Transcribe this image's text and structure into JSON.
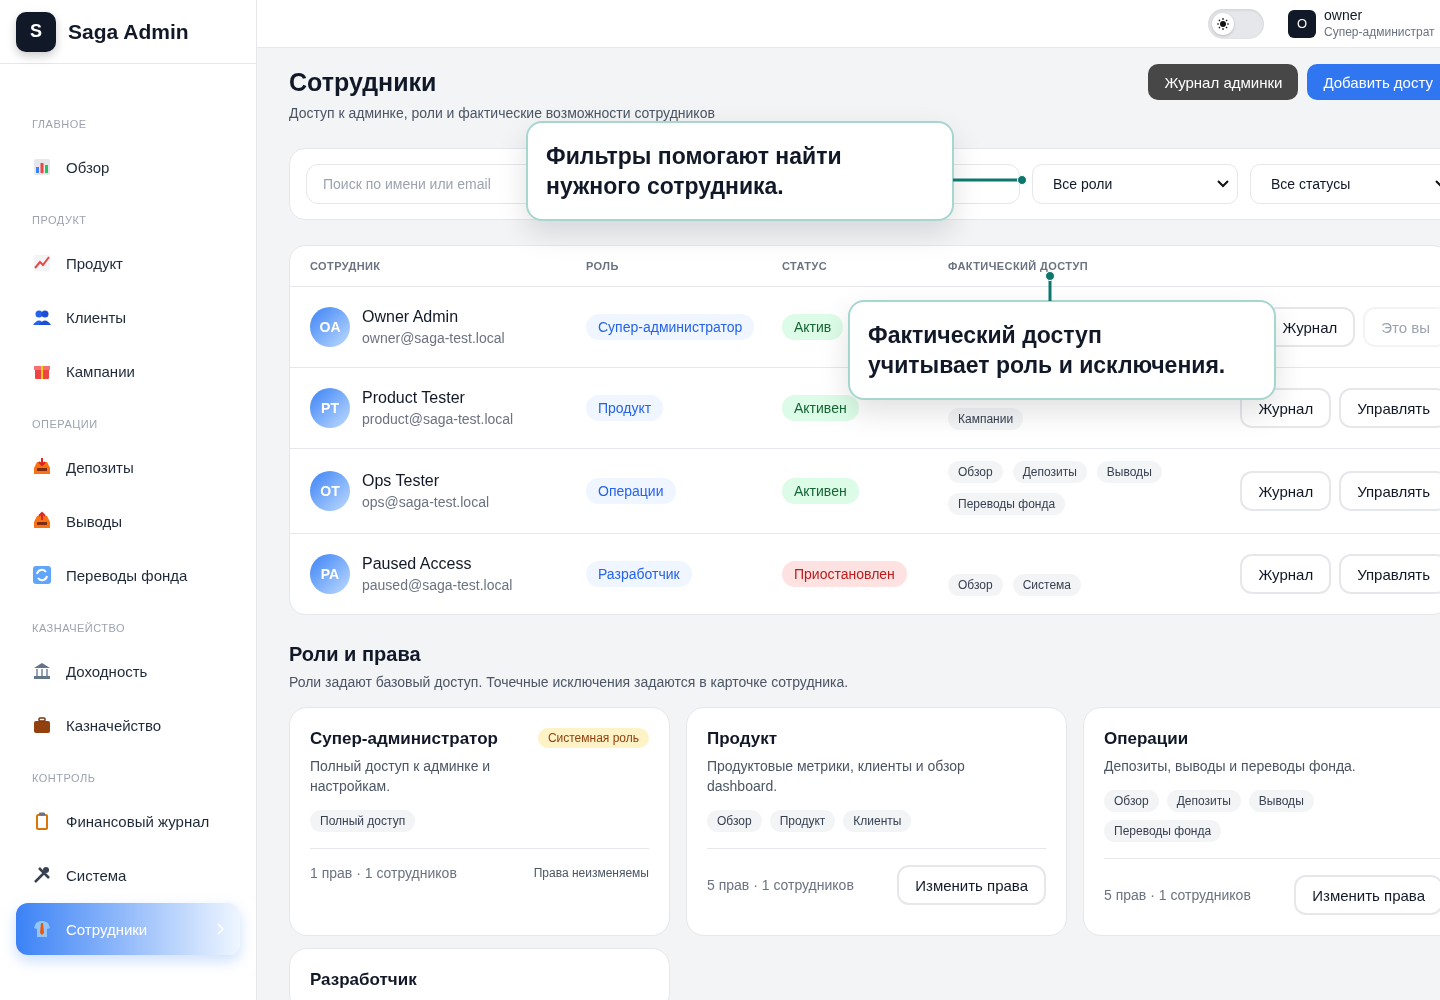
{
  "sidebar": {
    "logo_letter": "S",
    "brand": "Saga Admin",
    "sections": [
      {
        "title": "ГЛАВНОЕ",
        "items": [
          {
            "label": "Обзор",
            "selected": false
          }
        ]
      },
      {
        "title": "ПРОДУКТ",
        "items": [
          {
            "label": "Продукт",
            "selected": false
          },
          {
            "label": "Клиенты",
            "selected": false
          },
          {
            "label": "Кампании",
            "selected": false
          }
        ]
      },
      {
        "title": "ОПЕРАЦИИ",
        "items": [
          {
            "label": "Депозиты",
            "selected": false
          },
          {
            "label": "Выводы",
            "selected": false
          },
          {
            "label": "Переводы фонда",
            "selected": false
          }
        ]
      },
      {
        "title": "КАЗНАЧЕЙСТВО",
        "items": [
          {
            "label": "Доходность",
            "selected": false
          },
          {
            "label": "Казначейство",
            "selected": false
          }
        ]
      },
      {
        "title": "КОНТРОЛЬ",
        "items": [
          {
            "label": "Финансовый журнал",
            "selected": false
          },
          {
            "label": "Система",
            "selected": false
          },
          {
            "label": "Сотрудники",
            "selected": true
          }
        ]
      }
    ]
  },
  "topbar": {
    "theme_toggle": {
      "on": false
    },
    "user": {
      "initial": "O",
      "name": "owner",
      "role": "Супер-администрат"
    }
  },
  "page": {
    "title": "Сотрудники",
    "subtitle": "Доступ к админке, роли и фактические возможности сотрудников",
    "buttons": [
      {
        "label": "Журнал админки",
        "kind": "dark"
      },
      {
        "label": "Добавить досту",
        "kind": "primary"
      }
    ]
  },
  "filters": {
    "search": {
      "placeholder": "Поиск по имени или email"
    },
    "selects": [
      "Все роли",
      "Все статусы"
    ]
  },
  "table": {
    "columns": [
      "СОТРУДНИК",
      "РОЛЬ",
      "СТАТУС",
      "ФАКТИЧЕСКИЙ ДОСТУП"
    ],
    "rows": [
      {
        "initials": "OA",
        "name": "Owner Admin",
        "email": "owner@saga-test.local",
        "role": "Супер-администратор",
        "status": {
          "label": "Актив",
          "kind": "active"
        },
        "access": [],
        "actions": [
          {
            "label": "Журнал",
            "disabled": false
          },
          {
            "label": "Это вы",
            "disabled": true
          }
        ]
      },
      {
        "initials": "PT",
        "name": "Product Tester",
        "email": "product@saga-test.local",
        "role": "Продукт",
        "status": {
          "label": "Активен",
          "kind": "active"
        },
        "access": [
          "Кампании"
        ],
        "actions": [
          {
            "label": "Журнал",
            "disabled": false
          },
          {
            "label": "Управлять",
            "disabled": false
          }
        ]
      },
      {
        "initials": "OT",
        "name": "Ops Tester",
        "email": "ops@saga-test.local",
        "role": "Операции",
        "status": {
          "label": "Активен",
          "kind": "active"
        },
        "access": [
          "Обзор",
          "Депозиты",
          "Выводы",
          "Переводы фонда"
        ],
        "actions": [
          {
            "label": "Журнал",
            "disabled": false
          },
          {
            "label": "Управлять",
            "disabled": false
          }
        ]
      },
      {
        "initials": "PA",
        "name": "Paused Access",
        "email": "paused@saga-test.local",
        "role": "Разработчик",
        "status": {
          "label": "Приостановлен",
          "kind": "suspended"
        },
        "access": [
          "Обзор",
          "Система"
        ],
        "actions": [
          {
            "label": "Журнал",
            "disabled": false
          },
          {
            "label": "Управлять",
            "disabled": false
          }
        ]
      }
    ]
  },
  "roles": {
    "title": "Роли и права",
    "subtitle": "Роли задают базовый доступ. Точечные исключения задаются в карточке сотрудника.",
    "cards": [
      {
        "title": "Супер-администратор",
        "badge": "Системная роль",
        "description": "Полный доступ к админке и настройкам.",
        "permissions": [
          "Полный доступ"
        ],
        "summary": "1 прав · 1 сотрудников",
        "footer": {
          "kind": "note",
          "label": "Права неизменяемы"
        }
      },
      {
        "title": "Продукт",
        "description": "Продуктовые метрики, клиенты и обзор dashboard.",
        "permissions": [
          "Обзор",
          "Продукт",
          "Клиенты"
        ],
        "summary": "5 прав · 1 сотрудников",
        "footer": {
          "kind": "button",
          "label": "Изменить права"
        }
      },
      {
        "title": "Операции",
        "description": "Депозиты, выводы и переводы фонда.",
        "permissions": [
          "Обзор",
          "Депозиты",
          "Выводы",
          "Переводы фонда"
        ],
        "summary": "5 прав · 1 сотрудников",
        "footer": {
          "kind": "button",
          "label": "Изменить права"
        }
      },
      {
        "title": "Разработчик"
      }
    ]
  },
  "callouts": [
    {
      "text": "Фильтры помогают найти нужного сотрудника."
    },
    {
      "text": "Фактический доступ учитывает роль и исключения."
    }
  ]
}
